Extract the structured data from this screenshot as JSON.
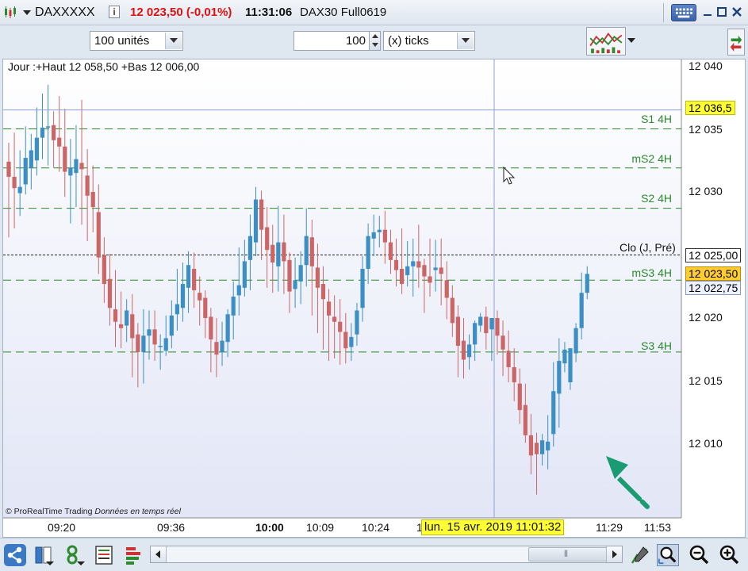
{
  "window": {
    "symbol": "DAXXXXX",
    "price_change": "12 023,50 (-0,01%)",
    "time": "11:31:06",
    "contract": "DAX30 Full0619",
    "info_label": "i"
  },
  "toolbar": {
    "units_selected": "100 unités",
    "quantity_value": "100",
    "ticks_selected": "(x) ticks"
  },
  "chart": {
    "header": "Jour :+Haut 12 058,50 +Bas 12 006,00",
    "copyright_brand": "© ProRealTime Trading",
    "copyright_note": "Données en temps réel",
    "cursor_date": "lun. 15 avr. 2019 11:01:32",
    "clo_label": "Clo (J, Pré)",
    "y_ticks": [
      "12 040",
      "12 035",
      "12 030",
      "12 020",
      "12 015",
      "12 010"
    ],
    "x_ticks": [
      "09:20",
      "09:36",
      "10:00",
      "10:09",
      "10:24",
      "1",
      "11:29",
      "11:53"
    ],
    "price_boxes": {
      "cursor": "12 036,5",
      "close_prev": "12 025,00",
      "last": "12 023,50",
      "other": "12 022,75"
    }
  },
  "chart_data": {
    "type": "candlestick",
    "up_color": "#3b8fc4",
    "down_color": "#cc6666",
    "levels_color": "#2a8a2a",
    "y_range": [
      12005,
      12041.5
    ],
    "levels": [
      {
        "name": "S1 4H",
        "value": 12035.0
      },
      {
        "name": "mS2 4H",
        "value": 12031.9
      },
      {
        "name": "S2 4H",
        "value": 12028.7
      },
      {
        "name": "mS3 4H",
        "value": 12023.0
      },
      {
        "name": "S3 4H",
        "value": 12017.3
      }
    ],
    "close_prev": 12025.0,
    "cursor_price": 12036.5,
    "candles": [
      {
        "o": 12032.4,
        "h": 12033.9,
        "c": 12031.2,
        "l": 12026.4
      },
      {
        "o": 12031.2,
        "h": 12034.7,
        "c": 12030.3,
        "l": 12027.1
      },
      {
        "o": 12029.9,
        "h": 12033.3,
        "c": 12030.4,
        "l": 12028.1
      },
      {
        "o": 12030.6,
        "h": 12035.2,
        "c": 12032.7,
        "l": 12029.8
      },
      {
        "o": 12031.9,
        "h": 12034.6,
        "c": 12033.3,
        "l": 12030.2
      },
      {
        "o": 12032.5,
        "h": 12036.7,
        "c": 12034.3,
        "l": 12031.3
      },
      {
        "o": 12034.3,
        "h": 12037.8,
        "c": 12035.1,
        "l": 12032.6
      },
      {
        "o": 12035.1,
        "h": 12038.5,
        "c": 12035.2,
        "l": 12032.1
      },
      {
        "o": 12035.3,
        "h": 12036.4,
        "c": 12034.1,
        "l": 12031.9
      },
      {
        "o": 12034.3,
        "h": 12037.6,
        "c": 12033.6,
        "l": 12031.6
      },
      {
        "o": 12033.6,
        "h": 12036.6,
        "c": 12031.6,
        "l": 12029.6
      },
      {
        "o": 12031.3,
        "h": 12034.2,
        "c": 12031.9,
        "l": 12027.5
      },
      {
        "o": 12031.5,
        "h": 12035.3,
        "c": 12032.6,
        "l": 12028.8
      },
      {
        "o": 12032.3,
        "h": 12037.3,
        "c": 12031.8,
        "l": 12027.4
      },
      {
        "o": 12031.3,
        "h": 12033.4,
        "c": 12029.7,
        "l": 12026.1
      },
      {
        "o": 12030.0,
        "h": 12032.1,
        "c": 12028.8,
        "l": 12026.8
      },
      {
        "o": 12028.4,
        "h": 12030.6,
        "c": 12024.8,
        "l": 12023.5
      },
      {
        "o": 12025.0,
        "h": 12026.4,
        "c": 12022.7,
        "l": 12021.2
      },
      {
        "o": 12023.1,
        "h": 12025.1,
        "c": 12020.8,
        "l": 12019.4
      },
      {
        "o": 12020.7,
        "h": 12023.8,
        "c": 12019.7,
        "l": 12017.7
      },
      {
        "o": 12019.5,
        "h": 12022.1,
        "c": 12019.2,
        "l": 12017.6
      },
      {
        "o": 12019.4,
        "h": 12021.5,
        "c": 12020.6,
        "l": 12018.1
      },
      {
        "o": 12020.3,
        "h": 12021.9,
        "c": 12018.4,
        "l": 12015.3
      },
      {
        "o": 12018.7,
        "h": 12019.6,
        "c": 12017.3,
        "l": 12014.5
      },
      {
        "o": 12017.3,
        "h": 12020.7,
        "c": 12018.6,
        "l": 12014.8
      },
      {
        "o": 12018.6,
        "h": 12020.6,
        "c": 12019.1,
        "l": 12016.7
      },
      {
        "o": 12019.1,
        "h": 12020.6,
        "c": 12017.9,
        "l": 12016.6
      },
      {
        "o": 12017.7,
        "h": 12018.7,
        "c": 12017.8,
        "l": 12015.9
      },
      {
        "o": 12017.4,
        "h": 12020.2,
        "c": 12018.4,
        "l": 12017.0
      },
      {
        "o": 12018.6,
        "h": 12021.4,
        "c": 12020.2,
        "l": 12017.6
      },
      {
        "o": 12020.3,
        "h": 12023.9,
        "c": 12021.1,
        "l": 12019.0
      },
      {
        "o": 12020.8,
        "h": 12024.4,
        "c": 12022.7,
        "l": 12019.7
      },
      {
        "o": 12022.4,
        "h": 12025.3,
        "c": 12024.2,
        "l": 12020.4
      },
      {
        "o": 12023.9,
        "h": 12025.2,
        "c": 12022.2,
        "l": 12020.8
      },
      {
        "o": 12022.0,
        "h": 12023.3,
        "c": 12021.4,
        "l": 12019.4
      },
      {
        "o": 12021.6,
        "h": 12022.2,
        "c": 12020.0,
        "l": 12018.4
      },
      {
        "o": 12020.1,
        "h": 12020.8,
        "c": 12018.3,
        "l": 12015.7
      },
      {
        "o": 12018.1,
        "h": 12020.0,
        "c": 12017.1,
        "l": 12015.3
      },
      {
        "o": 12017.3,
        "h": 12019.7,
        "c": 12018.2,
        "l": 12016.2
      },
      {
        "o": 12018.1,
        "h": 12020.7,
        "c": 12020.3,
        "l": 12016.9
      },
      {
        "o": 12020.2,
        "h": 12022.9,
        "c": 12021.7,
        "l": 12018.3
      },
      {
        "o": 12021.8,
        "h": 12025.6,
        "c": 12022.6,
        "l": 12020.2
      },
      {
        "o": 12022.4,
        "h": 12026.2,
        "c": 12024.5,
        "l": 12021.7
      },
      {
        "o": 12024.6,
        "h": 12028.2,
        "c": 12026.5,
        "l": 12022.2
      },
      {
        "o": 12026.0,
        "h": 12030.4,
        "c": 12029.4,
        "l": 12024.9
      },
      {
        "o": 12029.4,
        "h": 12030.1,
        "c": 12027.0,
        "l": 12024.6
      },
      {
        "o": 12027.2,
        "h": 12028.8,
        "c": 12025.4,
        "l": 12022.4
      },
      {
        "o": 12025.8,
        "h": 12027.4,
        "c": 12024.4,
        "l": 12022.0
      },
      {
        "o": 12024.1,
        "h": 12028.9,
        "c": 12026.0,
        "l": 12022.1
      },
      {
        "o": 12026.0,
        "h": 12028.2,
        "c": 12024.5,
        "l": 12021.9
      },
      {
        "o": 12024.6,
        "h": 12025.2,
        "c": 12022.1,
        "l": 12020.4
      },
      {
        "o": 12022.3,
        "h": 12024.8,
        "c": 12023.0,
        "l": 12020.8
      },
      {
        "o": 12022.9,
        "h": 12025.3,
        "c": 12024.2,
        "l": 12021.1
      },
      {
        "o": 12024.2,
        "h": 12028.7,
        "c": 12026.5,
        "l": 12022.5
      },
      {
        "o": 12026.4,
        "h": 12027.8,
        "c": 12024.1,
        "l": 12020.2
      },
      {
        "o": 12024.0,
        "h": 12025.9,
        "c": 12022.4,
        "l": 12018.8
      },
      {
        "o": 12022.7,
        "h": 12024.1,
        "c": 12021.5,
        "l": 12017.5
      },
      {
        "o": 12021.3,
        "h": 12022.3,
        "c": 12020.2,
        "l": 12016.6
      },
      {
        "o": 12020.1,
        "h": 12021.8,
        "c": 12019.7,
        "l": 12016.8
      },
      {
        "o": 12019.7,
        "h": 12021.5,
        "c": 12018.9,
        "l": 12016.3
      },
      {
        "o": 12018.9,
        "h": 12020.4,
        "c": 12017.6,
        "l": 12016.4
      },
      {
        "o": 12017.7,
        "h": 12019.6,
        "c": 12018.5,
        "l": 12016.6
      },
      {
        "o": 12018.7,
        "h": 12021.2,
        "c": 12020.6,
        "l": 12017.8
      },
      {
        "o": 12020.8,
        "h": 12024.9,
        "c": 12023.9,
        "l": 12019.7
      },
      {
        "o": 12023.9,
        "h": 12027.5,
        "c": 12026.5,
        "l": 12022.7
      },
      {
        "o": 12026.3,
        "h": 12028.2,
        "c": 12026.8,
        "l": 12024.9
      },
      {
        "o": 12026.8,
        "h": 12028.1,
        "c": 12027.0,
        "l": 12025.6
      },
      {
        "o": 12027.0,
        "h": 12028.5,
        "c": 12026.0,
        "l": 12024.3
      },
      {
        "o": 12026.0,
        "h": 12027.0,
        "c": 12024.6,
        "l": 12023.5
      },
      {
        "o": 12024.6,
        "h": 12026.3,
        "c": 12023.8,
        "l": 12022.5
      },
      {
        "o": 12023.9,
        "h": 12027.1,
        "c": 12022.7,
        "l": 12021.9
      },
      {
        "o": 12023.4,
        "h": 12026.1,
        "c": 12024.1,
        "l": 12022.5
      },
      {
        "o": 12024.1,
        "h": 12026.3,
        "c": 12024.5,
        "l": 12021.7
      },
      {
        "o": 12024.5,
        "h": 12027.4,
        "c": 12024.0,
        "l": 12022.4
      },
      {
        "o": 12024.2,
        "h": 12024.7,
        "c": 12023.3,
        "l": 12020.4
      },
      {
        "o": 12023.3,
        "h": 12026.3,
        "c": 12022.8,
        "l": 12021.7
      },
      {
        "o": 12023.8,
        "h": 12026.2,
        "c": 12024.0,
        "l": 12022.1
      },
      {
        "o": 12024.0,
        "h": 12026.3,
        "c": 12023.5,
        "l": 12021.0
      },
      {
        "o": 12023.0,
        "h": 12024.5,
        "c": 12021.6,
        "l": 12019.9
      },
      {
        "o": 12021.6,
        "h": 12022.6,
        "c": 12019.6,
        "l": 12018.5
      },
      {
        "o": 12020.1,
        "h": 12021.0,
        "c": 12017.8,
        "l": 12015.3
      },
      {
        "o": 12018.2,
        "h": 12020.0,
        "c": 12016.7,
        "l": 12015.2
      },
      {
        "o": 12016.9,
        "h": 12018.7,
        "c": 12017.9,
        "l": 12015.9
      },
      {
        "o": 12017.9,
        "h": 12019.8,
        "c": 12019.6,
        "l": 12016.6
      },
      {
        "o": 12019.4,
        "h": 12020.4,
        "c": 12020.1,
        "l": 12018.9
      },
      {
        "o": 12020.1,
        "h": 12020.9,
        "c": 12018.8,
        "l": 12017.5
      },
      {
        "o": 12019.1,
        "h": 12019.8,
        "c": 12020.0,
        "l": 12016.6
      },
      {
        "o": 12020.0,
        "h": 12020.6,
        "c": 12018.6,
        "l": 12017.1
      },
      {
        "o": 12018.6,
        "h": 12019.8,
        "c": 12017.5,
        "l": 12015.4
      },
      {
        "o": 12017.4,
        "h": 12019.0,
        "c": 12016.1,
        "l": 12014.9
      },
      {
        "o": 12016.1,
        "h": 12017.6,
        "c": 12014.9,
        "l": 12013.4
      },
      {
        "o": 12014.8,
        "h": 12016.0,
        "c": 12012.7,
        "l": 12011.6
      },
      {
        "o": 12013.1,
        "h": 12014.8,
        "c": 12010.7,
        "l": 12010.1
      },
      {
        "o": 12010.7,
        "h": 12012.4,
        "c": 12009.1,
        "l": 12007.6
      },
      {
        "o": 12010.1,
        "h": 12010.9,
        "c": 12009.2,
        "l": 12006.0
      },
      {
        "o": 12009.2,
        "h": 12010.8,
        "c": 12010.3,
        "l": 12008.3
      },
      {
        "o": 12009.5,
        "h": 12012.3,
        "c": 12010.2,
        "l": 12008.0
      },
      {
        "o": 12010.8,
        "h": 12016.5,
        "c": 12014.2,
        "l": 12009.8
      },
      {
        "o": 12014.0,
        "h": 12018.4,
        "c": 12016.6,
        "l": 12011.3
      },
      {
        "o": 12016.4,
        "h": 12018.1,
        "c": 12017.5,
        "l": 12015.7
      },
      {
        "o": 12014.9,
        "h": 12017.6,
        "c": 12017.6,
        "l": 12014.3
      },
      {
        "o": 12017.2,
        "h": 12019.6,
        "c": 12019.2,
        "l": 12016.5
      },
      {
        "o": 12019.2,
        "h": 12023.6,
        "c": 12022.0,
        "l": 12018.3
      },
      {
        "o": 12022.0,
        "h": 12024.1,
        "c": 12023.5,
        "l": 12021.5
      }
    ]
  }
}
